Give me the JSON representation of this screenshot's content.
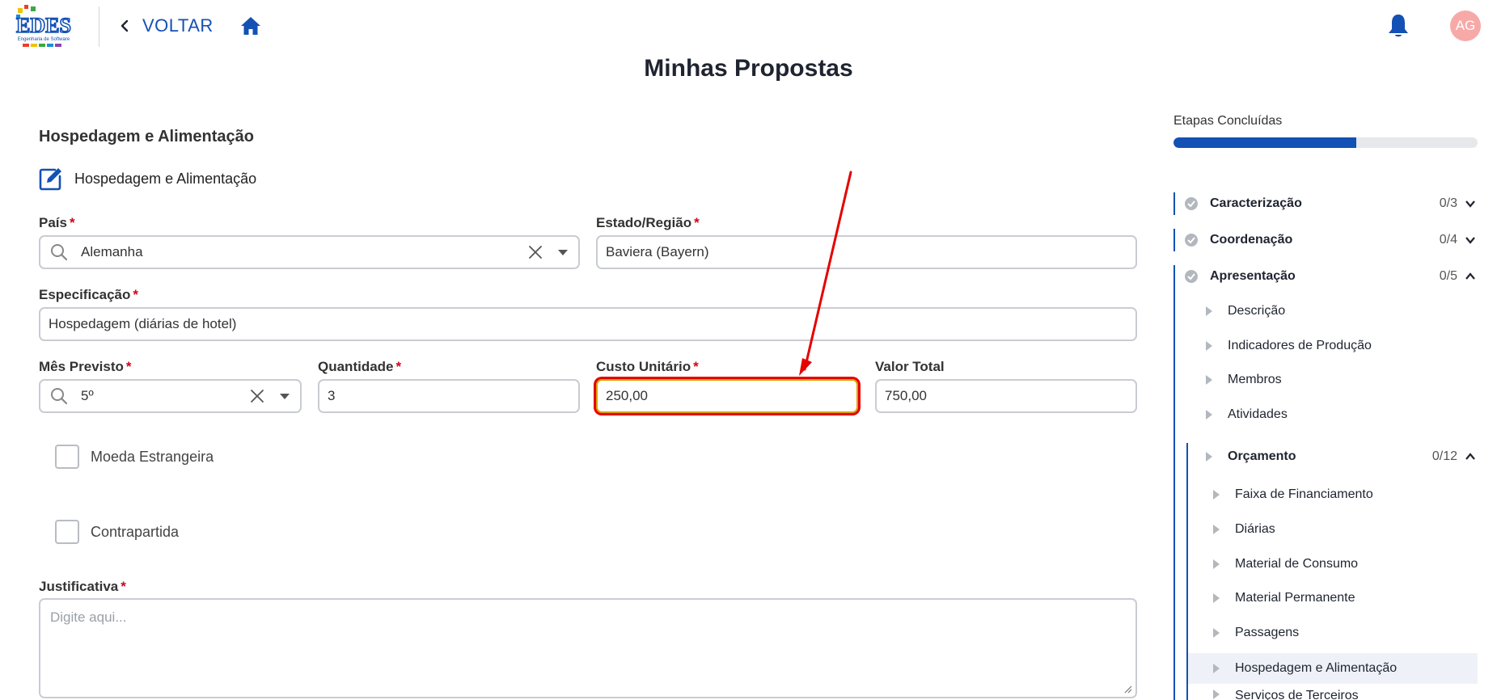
{
  "header": {
    "back_label": "VOLTAR",
    "avatar_initials": "AG",
    "logo_text": "EDES",
    "logo_sub": "Engenharia de Software"
  },
  "page_title": "Minhas Propostas",
  "form": {
    "section_title": "Hospedagem e Alimentação",
    "subheader_label": "Hospedagem e Alimentação",
    "pais": {
      "label": "País",
      "value": "Alemanha"
    },
    "estado": {
      "label": "Estado/Região",
      "value": "Baviera (Bayern)"
    },
    "especificacao": {
      "label": "Especificação",
      "value": "Hospedagem (diárias de hotel)"
    },
    "mes": {
      "label": "Mês Previsto",
      "value": "5º"
    },
    "quantidade": {
      "label": "Quantidade",
      "value": "3"
    },
    "custo": {
      "label": "Custo Unitário",
      "value": "250,00"
    },
    "valor_total": {
      "label": "Valor Total",
      "value": "750,00"
    },
    "moeda_label": "Moeda Estrangeira",
    "contrapartida_label": "Contrapartida",
    "justificativa": {
      "label": "Justificativa",
      "placeholder": "Digite aqui..."
    },
    "required_mark": "*"
  },
  "sidebar": {
    "title": "Etapas Concluídas",
    "progress_fraction": 0.6,
    "sections": [
      {
        "label": "Caracterização",
        "count": "0/3"
      },
      {
        "label": "Coordenação",
        "count": "0/4"
      },
      {
        "label": "Apresentação",
        "count": "0/5"
      }
    ],
    "apresentacao_items": [
      "Descrição",
      "Indicadores de Produção",
      "Membros",
      "Atividades"
    ],
    "orcamento": {
      "label": "Orçamento",
      "count": "0/12"
    },
    "orcamento_items": [
      "Faixa de Financiamento",
      "Diárias",
      "Material de Consumo",
      "Material Permanente",
      "Passagens",
      "Hospedagem e Alimentação",
      "Serviços de Terceiros"
    ]
  },
  "colors": {
    "primary": "#1351b4",
    "required": "#d0021b",
    "highlight_box": "#e60000",
    "avatar_bg": "#f7a9a8"
  }
}
